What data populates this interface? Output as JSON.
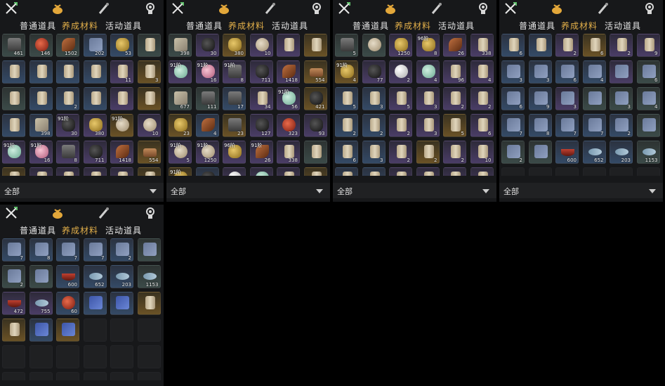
{
  "panels": [
    {
      "tabs": [
        "普通道具",
        "养成材料",
        "活动道具"
      ],
      "active_tab": 1,
      "filter": "全部",
      "rows": [
        [
          {
            "c": "g",
            "a": "stone",
            "n": "461"
          },
          {
            "c": "g",
            "a": "red",
            "n": "146"
          },
          {
            "c": "g",
            "a": "feather",
            "n": "1502"
          },
          {
            "c": "b",
            "a": "book",
            "n": "202"
          },
          {
            "c": "b",
            "a": "gold",
            "n": "53"
          },
          {
            "c": "g",
            "a": "scroll",
            "n": ""
          }
        ],
        [
          {
            "c": "b",
            "a": "scroll",
            "n": ""
          },
          {
            "c": "b",
            "a": "scroll",
            "n": ""
          },
          {
            "c": "b",
            "a": "scroll",
            "n": ""
          },
          {
            "c": "b",
            "a": "scroll",
            "n": ""
          },
          {
            "c": "p",
            "a": "scroll",
            "n": "11"
          },
          {
            "c": "y",
            "a": "scroll",
            "n": "3"
          }
        ],
        [
          {
            "c": "g",
            "a": "scroll",
            "n": ""
          },
          {
            "c": "b",
            "a": "scroll",
            "n": ""
          },
          {
            "c": "b",
            "a": "scroll",
            "n": "2"
          },
          {
            "c": "b",
            "a": "scroll",
            "n": ""
          },
          {
            "c": "p",
            "a": "scroll",
            "n": ""
          },
          {
            "c": "y",
            "a": "scroll",
            "n": ""
          }
        ],
        [
          {
            "c": "b",
            "a": "scroll",
            "n": ""
          },
          {
            "c": "b",
            "a": "cloth",
            "n": "398"
          },
          {
            "c": "p",
            "a": "ore",
            "n": "30",
            "t": "91阶"
          },
          {
            "c": "p",
            "a": "gold",
            "n": "380"
          },
          {
            "c": "y",
            "a": "shell",
            "n": "",
            "t": "91阶"
          },
          {
            "c": "p",
            "a": "shell",
            "n": "10"
          }
        ],
        [
          {
            "c": "p",
            "a": "jade",
            "n": "",
            "t": "91阶"
          },
          {
            "c": "p",
            "a": "pink",
            "n": "16",
            "t": "91阶"
          },
          {
            "c": "p",
            "a": "stone",
            "n": "8"
          },
          {
            "c": "p",
            "a": "ore",
            "n": "711"
          },
          {
            "c": "p",
            "a": "feather",
            "n": "1418"
          },
          {
            "c": "y",
            "a": "wood",
            "n": "554"
          }
        ],
        [
          {
            "c": "y",
            "a": "scroll",
            "n": ""
          },
          {
            "c": "p",
            "a": "scroll",
            "n": ""
          },
          {
            "c": "p",
            "a": "scroll",
            "n": ""
          },
          {
            "c": "p",
            "a": "scroll",
            "n": ""
          },
          {
            "c": "p",
            "a": "scroll",
            "n": ""
          },
          {
            "c": "y",
            "a": "scroll",
            "n": ""
          }
        ]
      ]
    },
    {
      "tabs": [
        "普通道具",
        "养成材料",
        "活动道具"
      ],
      "active_tab": 1,
      "filter": "全部",
      "rows": [
        [
          {
            "c": "g",
            "a": "cloth",
            "n": "398"
          },
          {
            "c": "p",
            "a": "ore",
            "n": "30"
          },
          {
            "c": "y",
            "a": "gold",
            "n": "380"
          },
          {
            "c": "p",
            "a": "shell",
            "n": "10"
          },
          {
            "c": "p",
            "a": "scroll",
            "n": ""
          },
          {
            "c": "y",
            "a": "scroll",
            "n": ""
          }
        ],
        [
          {
            "c": "p",
            "a": "jade",
            "n": "",
            "t": "91阶"
          },
          {
            "c": "p",
            "a": "pink",
            "n": "16",
            "t": "91阶"
          },
          {
            "c": "p",
            "a": "stone",
            "n": "8",
            "t": "91阶"
          },
          {
            "c": "p",
            "a": "ore",
            "n": "711"
          },
          {
            "c": "p",
            "a": "feather",
            "n": "1418"
          },
          {
            "c": "y",
            "a": "wood",
            "n": "554"
          }
        ],
        [
          {
            "c": "g",
            "a": "cloth",
            "n": "677"
          },
          {
            "c": "g",
            "a": "stone",
            "n": "111"
          },
          {
            "c": "b",
            "a": "stone",
            "n": "17"
          },
          {
            "c": "p",
            "a": "scroll",
            "n": "34"
          },
          {
            "c": "p",
            "a": "jade",
            "n": "56",
            "t": "91阶"
          },
          {
            "c": "y",
            "a": "ore",
            "n": "421"
          }
        ],
        [
          {
            "c": "y",
            "a": "gold",
            "n": "23"
          },
          {
            "c": "b",
            "a": "feather",
            "n": "4"
          },
          {
            "c": "y",
            "a": "stone",
            "n": "23"
          },
          {
            "c": "p",
            "a": "ore",
            "n": "127"
          },
          {
            "c": "p",
            "a": "red",
            "n": "323"
          },
          {
            "c": "p",
            "a": "ore",
            "n": "93"
          }
        ],
        [
          {
            "c": "p",
            "a": "shell",
            "n": "5",
            "t": "91阶"
          },
          {
            "c": "p",
            "a": "shell",
            "n": "1250",
            "t": "91阶"
          },
          {
            "c": "p",
            "a": "gold",
            "n": "",
            "t": "96阶"
          },
          {
            "c": "p",
            "a": "feather",
            "n": "26",
            "t": "91阶"
          },
          {
            "c": "p",
            "a": "scroll",
            "n": "338"
          },
          {
            "c": "g",
            "a": "scroll",
            "n": ""
          }
        ],
        [
          {
            "c": "y",
            "a": "gold",
            "n": "4",
            "t": "91阶"
          },
          {
            "c": "b",
            "a": "ore",
            "n": ""
          },
          {
            "c": "p",
            "a": "pearl",
            "n": ""
          },
          {
            "c": "p",
            "a": "jade",
            "n": ""
          },
          {
            "c": "p",
            "a": "scroll",
            "n": ""
          },
          {
            "c": "y",
            "a": "scroll",
            "n": ""
          }
        ]
      ]
    },
    {
      "tabs": [
        "普通道具",
        "养成材料",
        "活动道具"
      ],
      "active_tab": 1,
      "filter": "全部",
      "rows": [
        [
          {
            "c": "g",
            "a": "stone",
            "n": "5"
          },
          {
            "c": "g",
            "a": "shell",
            "n": ""
          },
          {
            "c": "p",
            "a": "gold",
            "n": "1250"
          },
          {
            "c": "p",
            "a": "gold",
            "n": "8",
            "t": "96阶"
          },
          {
            "c": "p",
            "a": "feather",
            "n": "26"
          },
          {
            "c": "p",
            "a": "scroll",
            "n": "338"
          }
        ],
        [
          {
            "c": "y",
            "a": "gold",
            "n": "4",
            "t": "91阶"
          },
          {
            "c": "p",
            "a": "ore",
            "n": "77"
          },
          {
            "c": "p",
            "a": "pearl",
            "n": "2"
          },
          {
            "c": "p",
            "a": "jade",
            "n": "4"
          },
          {
            "c": "p",
            "a": "scroll",
            "n": "96"
          },
          {
            "c": "p",
            "a": "scroll",
            "n": "4"
          }
        ],
        [
          {
            "c": "b",
            "a": "scroll",
            "n": "5"
          },
          {
            "c": "b",
            "a": "scroll",
            "n": "3"
          },
          {
            "c": "p",
            "a": "scroll",
            "n": "5"
          },
          {
            "c": "p",
            "a": "scroll",
            "n": "3"
          },
          {
            "c": "p",
            "a": "scroll",
            "n": "2"
          },
          {
            "c": "p",
            "a": "scroll",
            "n": "2"
          }
        ],
        [
          {
            "c": "b",
            "a": "scroll",
            "n": "2"
          },
          {
            "c": "b",
            "a": "scroll",
            "n": "2"
          },
          {
            "c": "p",
            "a": "scroll",
            "n": "2"
          },
          {
            "c": "p",
            "a": "scroll",
            "n": "3"
          },
          {
            "c": "y",
            "a": "scroll",
            "n": "5"
          },
          {
            "c": "p",
            "a": "scroll",
            "n": "6"
          }
        ],
        [
          {
            "c": "b",
            "a": "scroll",
            "n": "6"
          },
          {
            "c": "b",
            "a": "scroll",
            "n": "3"
          },
          {
            "c": "p",
            "a": "scroll",
            "n": "2"
          },
          {
            "c": "y",
            "a": "scroll",
            "n": "2"
          },
          {
            "c": "p",
            "a": "scroll",
            "n": "2"
          },
          {
            "c": "p",
            "a": "scroll",
            "n": "10"
          }
        ],
        [
          {
            "c": "b",
            "a": "scroll",
            "n": ""
          },
          {
            "c": "b",
            "a": "scroll",
            "n": ""
          },
          {
            "c": "p",
            "a": "scroll",
            "n": ""
          },
          {
            "c": "p",
            "a": "scroll",
            "n": ""
          },
          {
            "c": "p",
            "a": "scroll",
            "n": ""
          },
          {
            "c": "p",
            "a": "scroll",
            "n": ""
          }
        ]
      ]
    },
    {
      "tabs": [
        "普通道具",
        "养成材料",
        "活动道具"
      ],
      "active_tab": 1,
      "filter": "全部",
      "rows": [
        [
          {
            "c": "b",
            "a": "scroll",
            "n": "6"
          },
          {
            "c": "b",
            "a": "scroll",
            "n": ""
          },
          {
            "c": "p",
            "a": "scroll",
            "n": "2"
          },
          {
            "c": "y",
            "a": "scroll",
            "n": "6"
          },
          {
            "c": "p",
            "a": "scroll",
            "n": "2"
          },
          {
            "c": "p",
            "a": "scroll",
            "n": "9"
          }
        ],
        [
          {
            "c": "b",
            "a": "book",
            "n": "3"
          },
          {
            "c": "b",
            "a": "book",
            "n": "3"
          },
          {
            "c": "b",
            "a": "book",
            "n": "6"
          },
          {
            "c": "b",
            "a": "book",
            "n": "4"
          },
          {
            "c": "p",
            "a": "book",
            "n": ""
          },
          {
            "c": "g",
            "a": "book",
            "n": "6"
          }
        ],
        [
          {
            "c": "b",
            "a": "book",
            "n": "6"
          },
          {
            "c": "b",
            "a": "book",
            "n": "9"
          },
          {
            "c": "p",
            "a": "book",
            "n": "3"
          },
          {
            "c": "g",
            "a": "book",
            "n": ""
          },
          {
            "c": "g",
            "a": "book",
            "n": "3"
          },
          {
            "c": "g",
            "a": "book",
            "n": "4"
          }
        ],
        [
          {
            "c": "b",
            "a": "book",
            "n": "7"
          },
          {
            "c": "b",
            "a": "book",
            "n": "8"
          },
          {
            "c": "b",
            "a": "book",
            "n": "7"
          },
          {
            "c": "b",
            "a": "book",
            "n": "7"
          },
          {
            "c": "b",
            "a": "book",
            "n": "2"
          },
          {
            "c": "g",
            "a": "book",
            "n": ""
          }
        ],
        [
          {
            "c": "g",
            "a": "book",
            "n": "2"
          },
          {
            "c": "g",
            "a": "book",
            "n": ""
          },
          {
            "c": "b",
            "a": "bowl",
            "n": "600"
          },
          {
            "c": "b",
            "a": "fish",
            "n": "652"
          },
          {
            "c": "b",
            "a": "fish",
            "n": "203"
          },
          {
            "c": "g",
            "a": "fish",
            "n": "1153"
          }
        ],
        [
          {
            "c": "e",
            "a": "",
            "n": ""
          },
          {
            "c": "e",
            "a": "",
            "n": ""
          },
          {
            "c": "e",
            "a": "",
            "n": ""
          },
          {
            "c": "e",
            "a": "",
            "n": ""
          },
          {
            "c": "e",
            "a": "",
            "n": ""
          },
          {
            "c": "e",
            "a": "",
            "n": ""
          }
        ]
      ]
    },
    {
      "tabs": [
        "普通道具",
        "养成材料",
        "活动道具"
      ],
      "active_tab": 1,
      "filter": "",
      "rows": [
        [
          {
            "c": "b",
            "a": "book",
            "n": "7"
          },
          {
            "c": "b",
            "a": "book",
            "n": "8"
          },
          {
            "c": "b",
            "a": "book",
            "n": "7"
          },
          {
            "c": "b",
            "a": "book",
            "n": "7"
          },
          {
            "c": "b",
            "a": "book",
            "n": "2"
          },
          {
            "c": "g",
            "a": "book",
            "n": ""
          }
        ],
        [
          {
            "c": "g",
            "a": "book",
            "n": "2"
          },
          {
            "c": "g",
            "a": "book",
            "n": ""
          },
          {
            "c": "b",
            "a": "bowl",
            "n": "600"
          },
          {
            "c": "b",
            "a": "fish",
            "n": "652"
          },
          {
            "c": "b",
            "a": "fish",
            "n": "203"
          },
          {
            "c": "g",
            "a": "fish",
            "n": "1153"
          }
        ],
        [
          {
            "c": "p",
            "a": "bowl",
            "n": "472"
          },
          {
            "c": "p",
            "a": "fish",
            "n": "755"
          },
          {
            "c": "b",
            "a": "red",
            "n": "60"
          },
          {
            "c": "b",
            "a": "bluebook",
            "n": ""
          },
          {
            "c": "b",
            "a": "bluebook",
            "n": ""
          },
          {
            "c": "y",
            "a": "scroll",
            "n": ""
          }
        ],
        [
          {
            "c": "y",
            "a": "scroll",
            "n": ""
          },
          {
            "c": "b",
            "a": "bluebook",
            "n": ""
          },
          {
            "c": "y",
            "a": "bluebook",
            "n": ""
          },
          {
            "c": "e",
            "a": "",
            "n": ""
          },
          {
            "c": "e",
            "a": "",
            "n": ""
          },
          {
            "c": "e",
            "a": "",
            "n": ""
          }
        ],
        [
          {
            "c": "e",
            "a": "",
            "n": ""
          },
          {
            "c": "e",
            "a": "",
            "n": ""
          },
          {
            "c": "e",
            "a": "",
            "n": ""
          },
          {
            "c": "e",
            "a": "",
            "n": ""
          },
          {
            "c": "e",
            "a": "",
            "n": ""
          },
          {
            "c": "e",
            "a": "",
            "n": ""
          }
        ],
        [
          {
            "c": "e",
            "a": "",
            "n": ""
          },
          {
            "c": "e",
            "a": "",
            "n": ""
          },
          {
            "c": "e",
            "a": "",
            "n": ""
          },
          {
            "c": "e",
            "a": "",
            "n": ""
          },
          {
            "c": "e",
            "a": "",
            "n": ""
          },
          {
            "c": "e",
            "a": "",
            "n": ""
          }
        ]
      ]
    }
  ],
  "colors": {
    "active_tab": "#e3b04a",
    "panel_bg": "#17181a"
  },
  "icons": [
    "crossed-swords-icon",
    "money-bag-icon",
    "brush-icon",
    "medal-icon",
    "dropdown-arrow-icon"
  ]
}
